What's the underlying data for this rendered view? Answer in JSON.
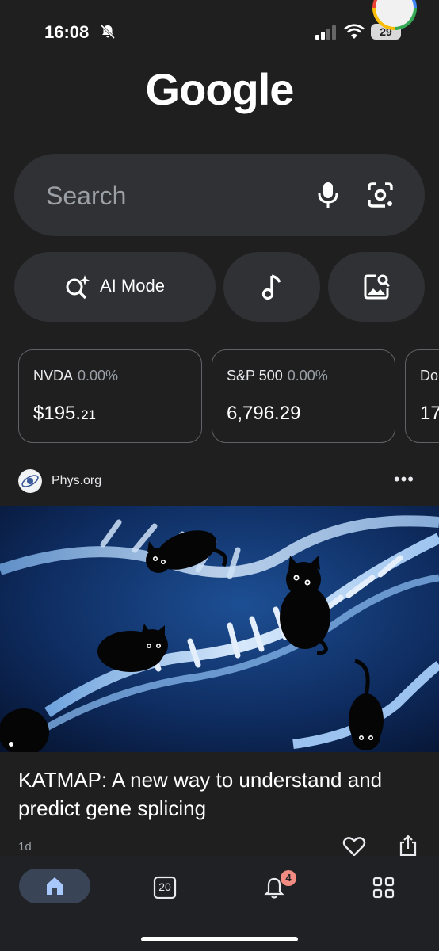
{
  "status": {
    "time": "16:08",
    "battery": "29"
  },
  "logo": {
    "text": "Google"
  },
  "search": {
    "placeholder": "Search"
  },
  "quick_actions": {
    "ai_mode_label": "AI Mode"
  },
  "stocks": [
    {
      "symbol": "NVDA",
      "change": "0.00%",
      "price_main": "$195.",
      "price_cents": "21"
    },
    {
      "symbol": "S&P 500",
      "change": "0.00%",
      "price_main": "6,796.29",
      "price_cents": ""
    },
    {
      "symbol": "Do",
      "change": "",
      "price_main": "17",
      "price_cents": ""
    }
  ],
  "article": {
    "source": "Phys.org",
    "headline": "KATMAP: A new way to understand and predict gene splicing",
    "age": "1d"
  },
  "bottom_nav": {
    "date_number": "20",
    "notifications_count": "4"
  },
  "colors": {
    "background": "#1f1f1f",
    "surface": "#303134",
    "nav_active": "#394457",
    "badge": "#f28b82"
  }
}
